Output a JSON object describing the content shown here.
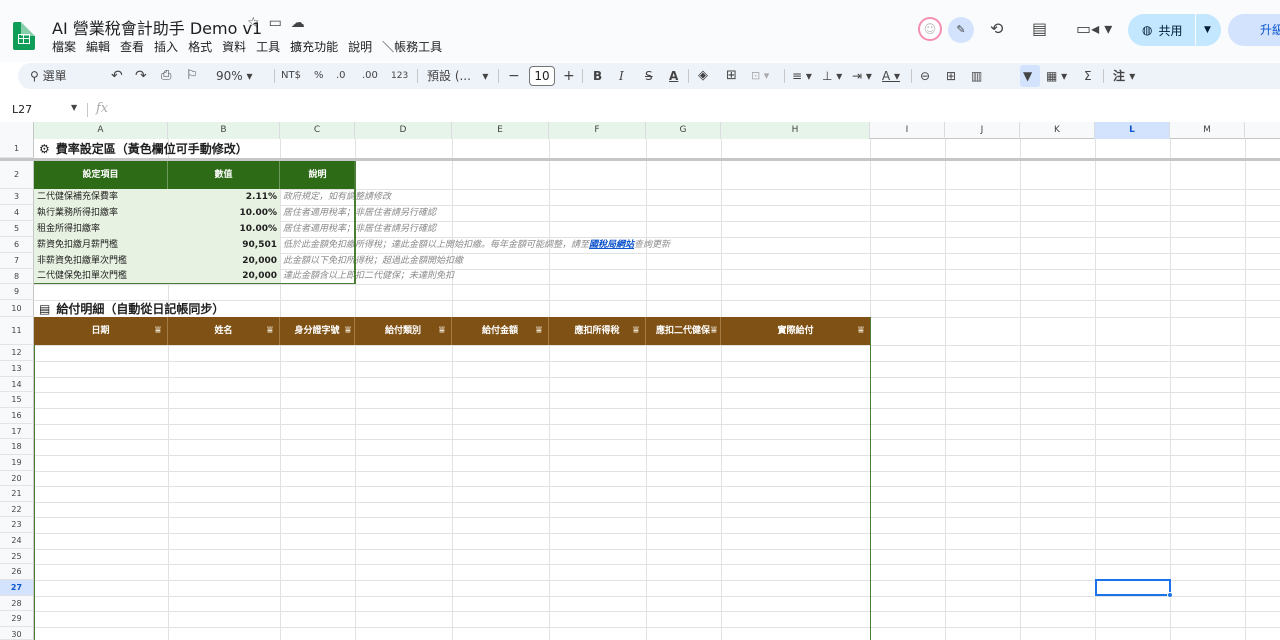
{
  "doc": {
    "title": "AI 營業稅會計助手 Demo v1"
  },
  "menu": [
    "檔案",
    "編輯",
    "查看",
    "插入",
    "格式",
    "資料",
    "工具",
    "擴充功能",
    "說明",
    "帳務工具"
  ],
  "header": {
    "share_label": "共用",
    "upgrade_label": "升級"
  },
  "toolbar": {
    "search_label": "選單",
    "zoom": "90%",
    "currency": "NT$",
    "percent": "%",
    "dec_decrease": ".0",
    "dec_increase": ".00",
    "number_format": "123",
    "font_name": "預設 (...",
    "font_size": "10",
    "bold": "B",
    "italic": "I",
    "strike": "S",
    "text_color": "A",
    "sum": "Σ",
    "note": "注"
  },
  "formula_bar": {
    "cell_ref": "L27",
    "fx": "fx"
  },
  "columns": [
    "A",
    "B",
    "C",
    "D",
    "E",
    "F",
    "G",
    "H",
    "I",
    "J",
    "K",
    "L",
    "M"
  ],
  "rows": [
    "1",
    "2",
    "3",
    "4",
    "5",
    "6",
    "7",
    "8",
    "9",
    "10",
    "11",
    "12",
    "13",
    "14",
    "15",
    "16",
    "17",
    "18",
    "19",
    "20",
    "21",
    "22",
    "23",
    "24",
    "25",
    "26",
    "27",
    "28",
    "29",
    "30"
  ],
  "selected": {
    "column": "L",
    "row": "27"
  },
  "section1": {
    "title": "費率設定區（黃色欄位可手動修改）",
    "headers": [
      "設定項目",
      "數值",
      "說明"
    ],
    "items": [
      {
        "name": "二代健保補充保費率",
        "value": "2.11%",
        "note": "政府規定，如有調整請修改"
      },
      {
        "name": "執行業務所得扣繳率",
        "value": "10.00%",
        "note": "居住者適用稅率；非居住者請另行確認"
      },
      {
        "name": "租金所得扣繳率",
        "value": "10.00%",
        "note": "居住者適用稅率；非居住者請另行確認"
      },
      {
        "name": "薪資免扣繳月薪門檻",
        "value": "90,501",
        "note": "低於此金額免扣繳所得稅；達此金額以上開始扣繳。每年金額可能調整，請至",
        "link": "國稅局網站",
        "note_after": "查詢更新"
      },
      {
        "name": "非薪資免扣繳單次門檻",
        "value": "20,000",
        "note": "此金額以下免扣所得稅；超過此金額開始扣繳"
      },
      {
        "name": "二代健保免扣單次門檻",
        "value": "20,000",
        "note": "達此金額含以上即扣二代健保；未達則免扣"
      }
    ]
  },
  "section2": {
    "title": "給付明細（自動從日記帳同步）",
    "headers": [
      "日期",
      "姓名",
      "身分證字號",
      "給付類別",
      "給付金額",
      "應扣所得稅",
      "應扣二代健保",
      "實際給付"
    ]
  }
}
